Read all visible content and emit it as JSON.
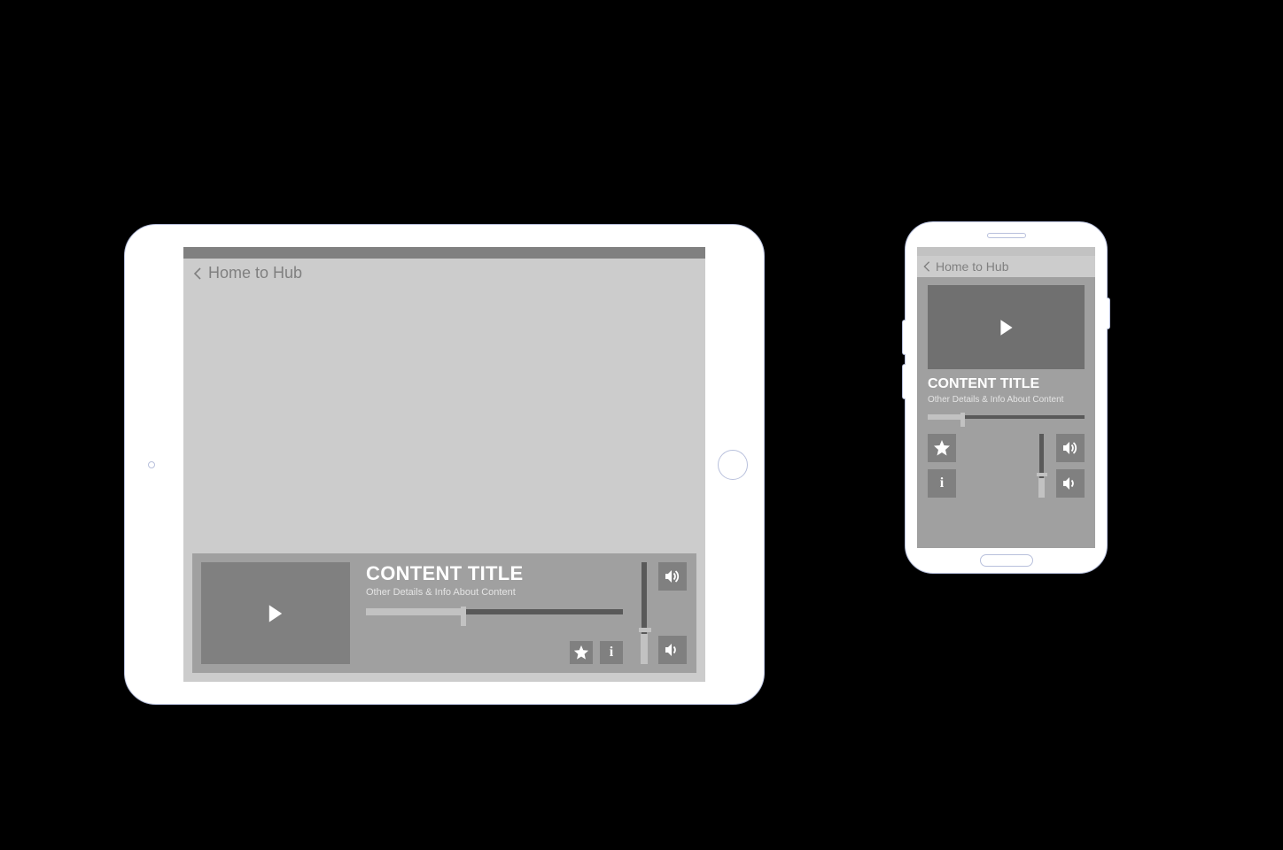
{
  "tablet": {
    "nav": {
      "back_label": "Home to Hub"
    },
    "player": {
      "title": "CONTENT TITLE",
      "subtitle": "Other Details & Info About Content",
      "progress_pct": 38,
      "volume_pct": 30
    }
  },
  "phone": {
    "nav": {
      "back_label": "Home to Hub"
    },
    "player": {
      "title": "CONTENT TITLE",
      "subtitle": "Other Details & Info About Content",
      "progress_pct": 22,
      "volume_pct": 30
    }
  },
  "icons": {
    "play": "play-icon",
    "star": "star-icon",
    "info": "info-icon",
    "vol_up": "volume-up-icon",
    "vol_down": "volume-down-icon",
    "back": "back-chevron-icon"
  }
}
